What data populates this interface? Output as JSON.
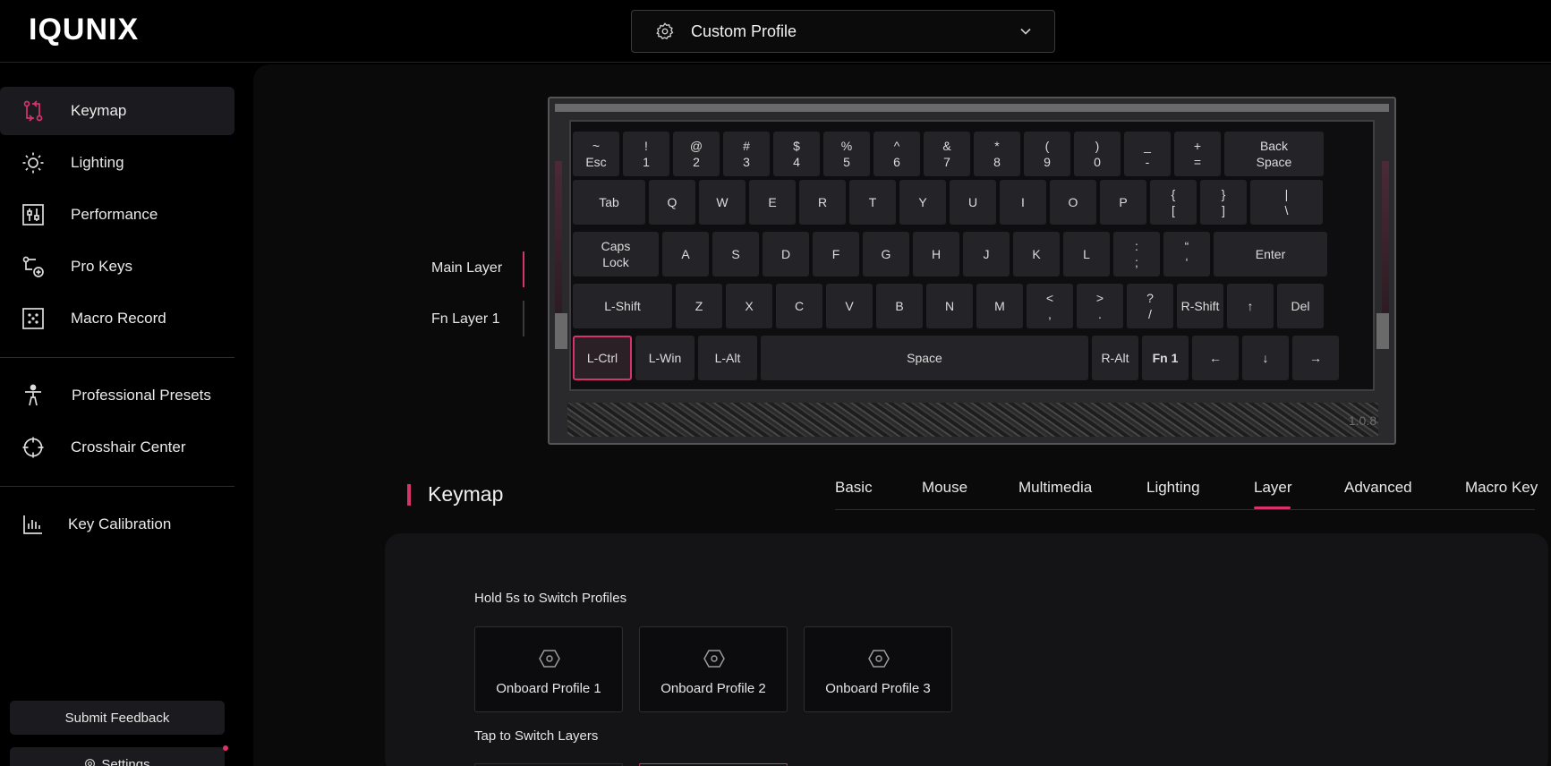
{
  "app": {
    "logo": "IQUNIX"
  },
  "header": {
    "profile": "Custom Profile"
  },
  "sidebar": {
    "items": [
      {
        "label": "Keymap",
        "icon": "keymap-icon",
        "active": true
      },
      {
        "label": "Lighting",
        "icon": "sun-icon"
      },
      {
        "label": "Performance",
        "icon": "sliders-icon"
      },
      {
        "label": "Pro Keys",
        "icon": "pro-keys-icon"
      },
      {
        "label": "Macro Record",
        "icon": "macro-icon"
      },
      {
        "label": "Professional Presets",
        "icon": "figure-icon"
      },
      {
        "label": "Crosshair Center",
        "icon": "crosshair-icon"
      },
      {
        "label": "Key Calibration",
        "icon": "bar-chart-icon"
      }
    ],
    "feedback": "Submit Feedback",
    "settings": "Settings"
  },
  "layers": {
    "main": "Main Layer",
    "fn": "Fn Layer 1"
  },
  "keyboard": {
    "version": "1.0.8",
    "rows": [
      [
        {
          "t": "~",
          "b": "Esc"
        },
        {
          "t": "!",
          "b": "1"
        },
        {
          "t": "@",
          "b": "2"
        },
        {
          "t": "#",
          "b": "3"
        },
        {
          "t": "$",
          "b": "4"
        },
        {
          "t": "%",
          "b": "5"
        },
        {
          "t": "^",
          "b": "6"
        },
        {
          "t": "&",
          "b": "7"
        },
        {
          "t": "*",
          "b": "8"
        },
        {
          "t": "(",
          "b": "9"
        },
        {
          "t": ")",
          "b": "0"
        },
        {
          "t": "_",
          "b": "-"
        },
        {
          "t": "+",
          "b": "="
        },
        {
          "t": "Back",
          "b": "Space"
        }
      ],
      [
        {
          "t": "Tab"
        },
        {
          "t": "Q"
        },
        {
          "t": "W"
        },
        {
          "t": "E"
        },
        {
          "t": "R"
        },
        {
          "t": "T"
        },
        {
          "t": "Y"
        },
        {
          "t": "U"
        },
        {
          "t": "I"
        },
        {
          "t": "O"
        },
        {
          "t": "P"
        },
        {
          "t": "{",
          "b": "["
        },
        {
          "t": "}",
          "b": "]"
        },
        {
          "t": "|",
          "b": "\\"
        }
      ],
      [
        {
          "t": "Caps",
          "b": "Lock"
        },
        {
          "t": "A"
        },
        {
          "t": "S"
        },
        {
          "t": "D"
        },
        {
          "t": "F"
        },
        {
          "t": "G"
        },
        {
          "t": "H"
        },
        {
          "t": "J"
        },
        {
          "t": "K"
        },
        {
          "t": "L"
        },
        {
          "t": ":",
          "b": ";"
        },
        {
          "t": "“",
          "b": "‘"
        },
        {
          "t": "Enter"
        }
      ],
      [
        {
          "t": "L-Shift"
        },
        {
          "t": "Z"
        },
        {
          "t": "X"
        },
        {
          "t": "C"
        },
        {
          "t": "V"
        },
        {
          "t": "B"
        },
        {
          "t": "N"
        },
        {
          "t": "M"
        },
        {
          "t": "<",
          "b": ","
        },
        {
          "t": ">",
          "b": "."
        },
        {
          "t": "?",
          "b": "/"
        },
        {
          "t": "R-Shift"
        },
        {
          "t": "↑"
        },
        {
          "t": "Del"
        }
      ],
      [
        {
          "t": "L-Ctrl"
        },
        {
          "t": "L-Win"
        },
        {
          "t": "L-Alt"
        },
        {
          "t": "Space"
        },
        {
          "t": "R-Alt"
        },
        {
          "t": "Fn 1"
        },
        {
          "t": "←"
        },
        {
          "t": "↓"
        },
        {
          "t": "→"
        }
      ]
    ]
  },
  "keymap": {
    "title": "Keymap",
    "tabs": [
      "Basic",
      "Mouse",
      "Multimedia",
      "Lighting",
      "Layer",
      "Advanced",
      "Macro Key"
    ],
    "active_tab": "Layer",
    "hold_label": "Hold 5s to Switch Profiles",
    "profiles": [
      "Onboard Profile 1",
      "Onboard Profile 2",
      "Onboard Profile 3"
    ],
    "tap_label": "Tap to Switch Layers"
  },
  "colors": {
    "accent": "#d6336c",
    "background": "#000000",
    "panel": "#141417"
  }
}
